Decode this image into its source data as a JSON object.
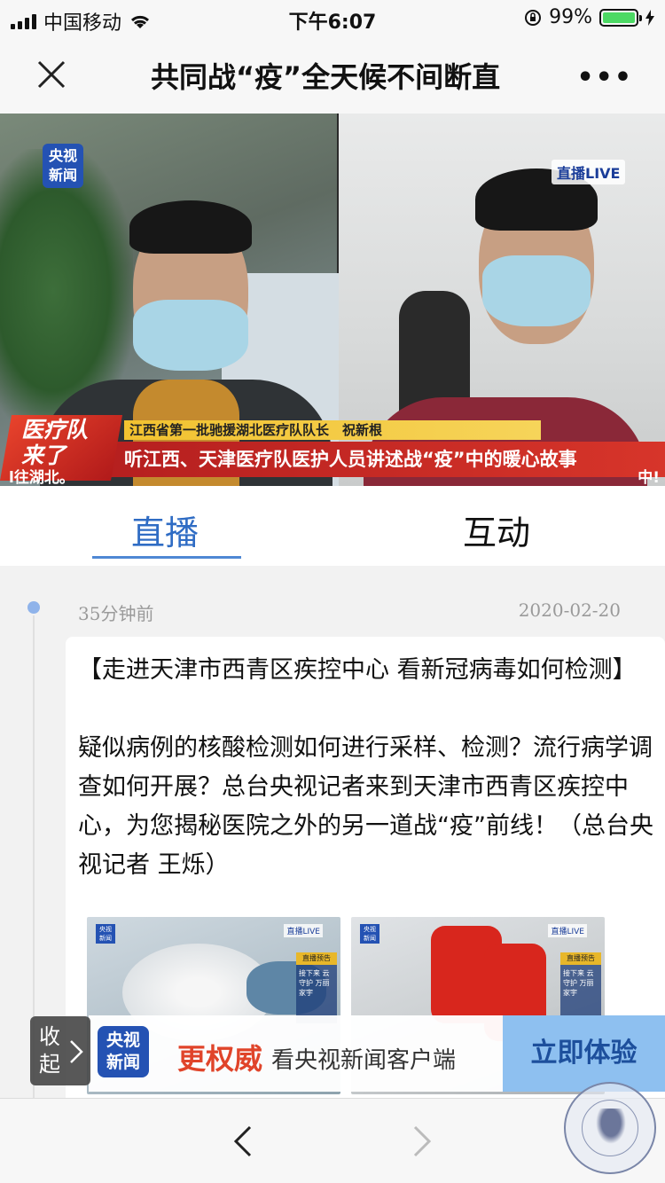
{
  "status_bar": {
    "carrier": "中国移动",
    "time": "下午6:07",
    "battery_percent": "99%",
    "battery_level": 0.99,
    "icons": [
      "signal-icon",
      "wifi-icon",
      "orientation-lock-icon",
      "battery-icon",
      "charging-icon"
    ]
  },
  "navbar": {
    "title": "共同战“疫”全天候不间断直",
    "more": "•••",
    "icons": [
      "close-icon",
      "more-icon"
    ]
  },
  "video": {
    "cctv_logo_line1": "央视",
    "cctv_logo_line2": "新闻",
    "live_tag": "直播LIVE",
    "badge_line1": "医疗队",
    "badge_line2": "来了",
    "caption_sub": "江西省第一批驰援湖北医疗队队长　祝新根",
    "caption_main": "听江西、天津医疗队医护人员讲述战“疫”中的暖心故事",
    "ticker_left": "l往湖北。",
    "ticker_right": "中!"
  },
  "tabs": {
    "live": "直播",
    "interact": "互动",
    "active": "live"
  },
  "post": {
    "time_ago": "35分钟前",
    "date": "2020-02-20",
    "title": "【走进天津市西青区疾控中心 看新冠病毒如何检测】",
    "body": "疑似病例的核酸检测如何进行采样、检测？流行病学调查如何开展？总台央视记者来到天津市西青区疾控中心，为您揭秘医院之外的另一道战“疫”前线！（总台央视记者 王烁）",
    "thumbnails": [
      {
        "logo1": "央视",
        "logo2": "新闻",
        "tag": "直播LIVE",
        "badge": "直播预告",
        "side": "接下来 云守护 万丽家宇"
      },
      {
        "logo1": "央视",
        "logo2": "新闻",
        "tag": "直播LIVE",
        "badge": "直播预告",
        "side": "接下来 云守护 万丽家宇"
      }
    ]
  },
  "promo": {
    "collapse_label": "收起",
    "logo_line1": "央视",
    "logo_line2": "新闻",
    "strong": "更权威",
    "text": "看央视新闻客户端",
    "button": "立即体验"
  },
  "bottom_bar": {
    "icons": [
      "back-arrow-icon",
      "forward-arrow-icon"
    ]
  },
  "colors": {
    "accent": "#2f6cc4",
    "promo_red": "#e0442a",
    "promo_button": "#8ec0f0",
    "cctv_blue": "#2452b3"
  }
}
